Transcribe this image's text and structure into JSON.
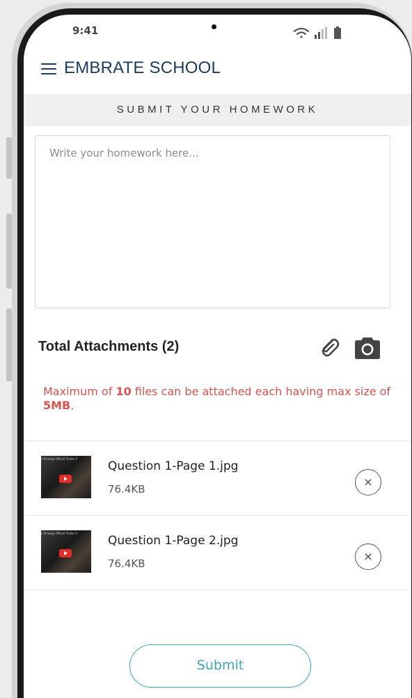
{
  "status_bar": {
    "time": "9:41"
  },
  "header": {
    "title": "EMBRATE SCHOOL",
    "menu_icon": "hamburger-menu-icon"
  },
  "section": {
    "title": "SUBMIT YOUR HOMEWORK"
  },
  "homework": {
    "placeholder": "Write your homework here...",
    "value": ""
  },
  "attachments": {
    "title": "Total Attachments (2)",
    "attach_icon": "paperclip-icon",
    "camera_icon": "camera-icon",
    "note": {
      "prefix": "Maximum of ",
      "max_files": "10",
      "middle": " files can be attached each having max size of ",
      "max_size": "5MB",
      "suffix": "."
    },
    "items": [
      {
        "name": "Question 1-Page 1.jpg",
        "size": "76.4KB",
        "thumb_caption": "e Strange Official Trailer 2"
      },
      {
        "name": "Question 1-Page 2.jpg",
        "size": "76.4KB",
        "thumb_caption": "e Strange Official Trailer 2"
      }
    ],
    "remove_symbol": "×"
  },
  "submit": {
    "label": "Submit"
  },
  "colors": {
    "brand": "#1f3a5f",
    "accent": "#3fa7ad",
    "warning": "#d9534f"
  }
}
